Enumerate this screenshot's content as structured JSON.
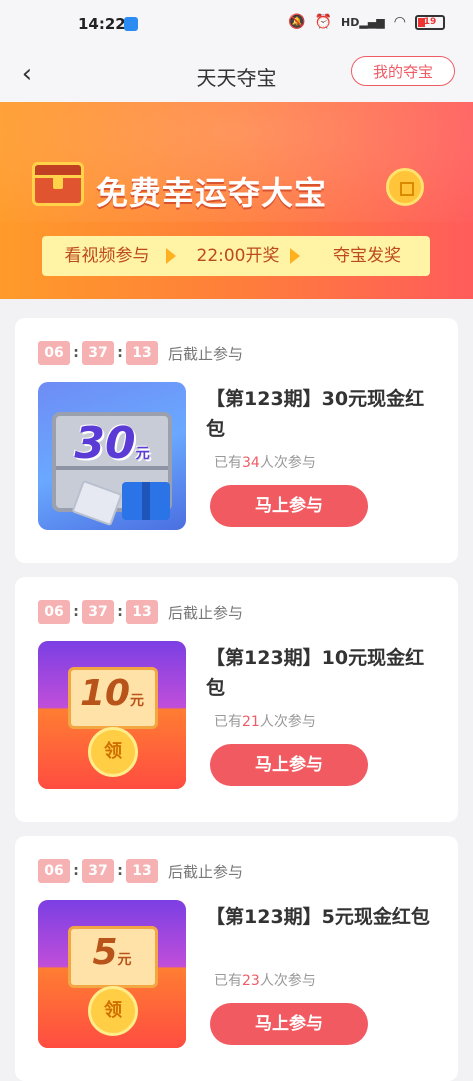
{
  "status_bar": {
    "time": "14:22",
    "battery": "19",
    "hd_label": "HD"
  },
  "header": {
    "title": "天天夺宝",
    "my_treasure_label": "我的夺宝",
    "back_symbol": "‹"
  },
  "banner": {
    "title": "免费幸运夺大宝",
    "steps": [
      "看视频参与",
      "22:00开奖",
      "夺宝发奖"
    ]
  },
  "timer_suffix": "后截止参与",
  "participants_prefix": "已有",
  "participants_suffix": "人次参与",
  "join_label": "马上参与",
  "claim_glyph": "领",
  "yuan_glyph": "元",
  "items": [
    {
      "countdown": [
        "06",
        "37",
        "13"
      ],
      "title": "【第123期】30元现金红包",
      "image_amount": "30",
      "participants": "34"
    },
    {
      "countdown": [
        "06",
        "37",
        "13"
      ],
      "title": "【第123期】10元现金红包",
      "image_amount": "10",
      "participants": "21"
    },
    {
      "countdown": [
        "06",
        "37",
        "13"
      ],
      "title": "【第123期】5元现金红包",
      "image_amount": "5",
      "participants": "23"
    }
  ],
  "colors": {
    "accent": "#f15a60",
    "banner_start": "#ff9b2a",
    "banner_end": "#ff5c5b",
    "timer_box": "#f6b1b2"
  }
}
